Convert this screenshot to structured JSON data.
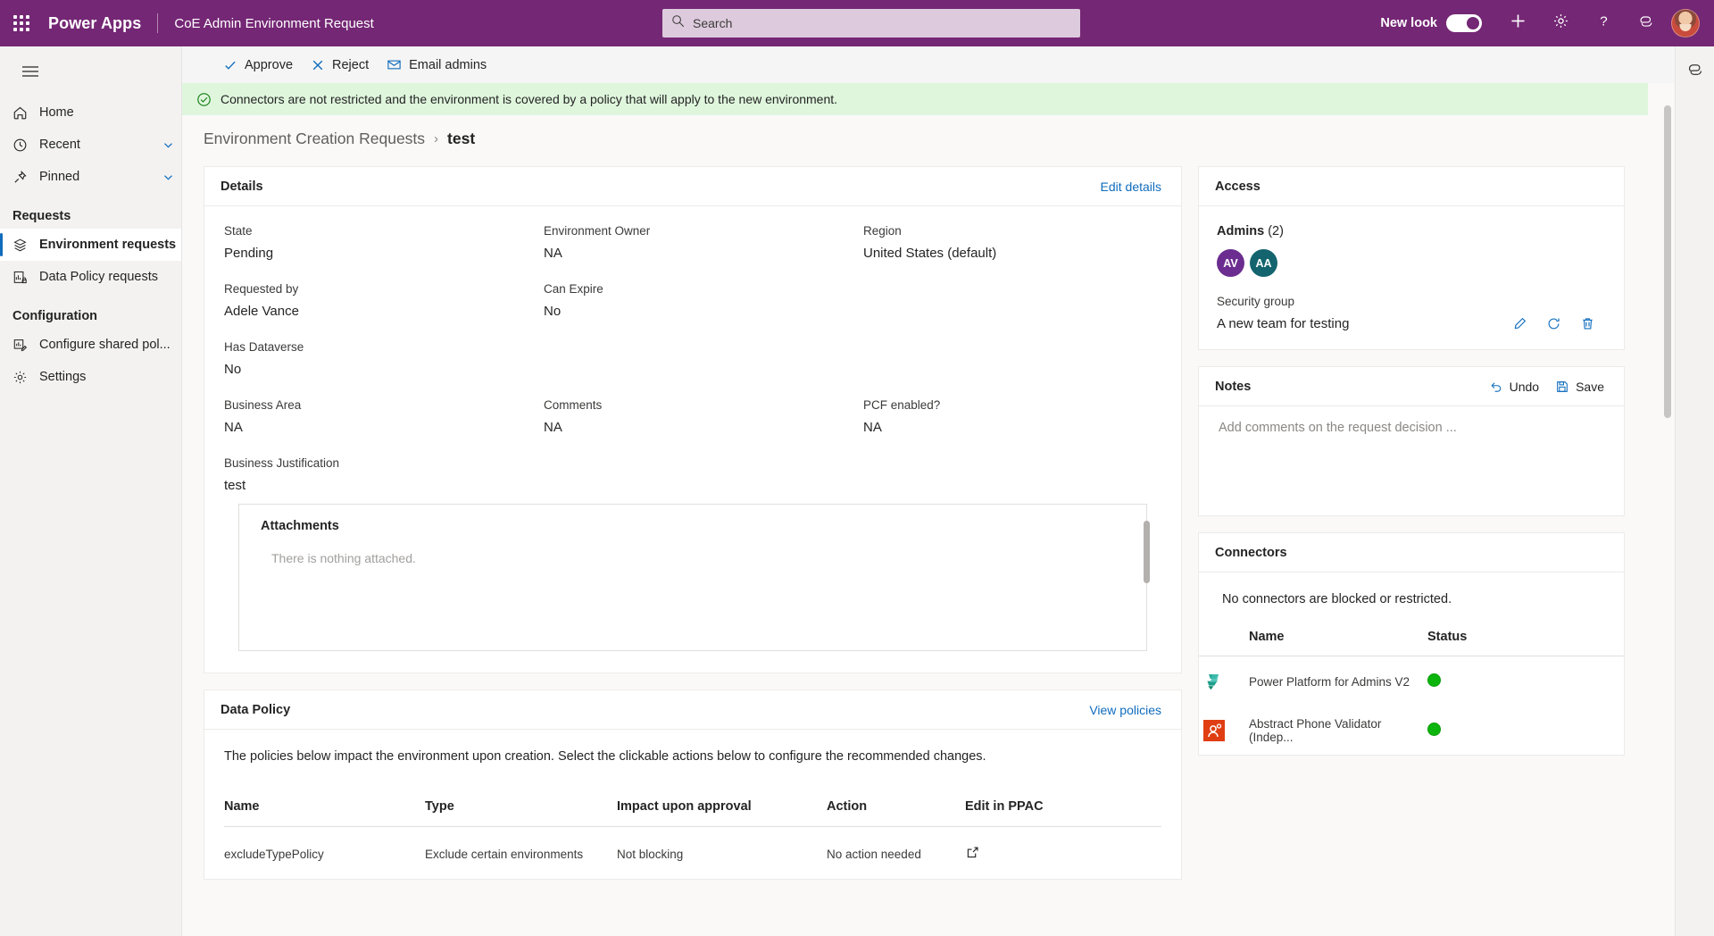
{
  "suitebar": {
    "waffle_label": "App launcher",
    "brand": "Power Apps",
    "app_name": "CoE Admin Environment Request",
    "search_placeholder": "Search",
    "new_look_label": "New look",
    "toggle_on": true,
    "icons": [
      "plus-icon",
      "gear-icon",
      "help-icon",
      "copilot-icon"
    ],
    "accent": "#742774"
  },
  "sidebar": {
    "hamburger": "menu-icon",
    "items": [
      {
        "label": "Home",
        "icon": "home-icon",
        "chevron": false,
        "selected": false
      },
      {
        "label": "Recent",
        "icon": "clock-icon",
        "chevron": true,
        "selected": false
      },
      {
        "label": "Pinned",
        "icon": "pin-icon",
        "chevron": true,
        "selected": false
      }
    ],
    "group_requests": "Requests",
    "requests_items": [
      {
        "label": "Environment requests",
        "icon": "layers-icon",
        "selected": true
      },
      {
        "label": "Data Policy requests",
        "icon": "policy-icon",
        "selected": false
      }
    ],
    "group_configuration": "Configuration",
    "configuration_items": [
      {
        "label": "Configure shared pol...",
        "icon": "configure-icon",
        "selected": false
      },
      {
        "label": "Settings",
        "icon": "gear-icon",
        "selected": false
      }
    ]
  },
  "commandbar": {
    "approve": "Approve",
    "reject": "Reject",
    "email_admins": "Email admins"
  },
  "banner": {
    "icon": "check-circle-icon",
    "text": "Connectors are not restricted and the environment is covered by a policy that will apply to the new environment.",
    "background": "#dff6dd"
  },
  "breadcrumb": {
    "parent": "Environment Creation Requests",
    "separator": "›",
    "current": "test"
  },
  "details": {
    "title": "Details",
    "edit_link": "Edit details",
    "fields": [
      {
        "label": "State",
        "value": "Pending"
      },
      {
        "label": "Environment Owner",
        "value": "NA"
      },
      {
        "label": "Region",
        "value": "United States (default)"
      },
      {
        "label": "Requested by",
        "value": "Adele Vance"
      },
      {
        "label": "Can Expire",
        "value": "No"
      },
      {
        "label": "Has Dataverse",
        "value": "No"
      },
      {
        "label": "Business Area",
        "value": "NA"
      },
      {
        "label": "Comments",
        "value": "NA"
      },
      {
        "label": "PCF enabled?",
        "value": "NA"
      },
      {
        "label": "Business Justification",
        "value": "test"
      }
    ],
    "attachments": {
      "title": "Attachments",
      "empty_text": "There is nothing attached."
    }
  },
  "data_policy": {
    "title": "Data Policy",
    "view_link": "View policies",
    "description": "The policies below impact the environment upon creation. Select the clickable actions below to configure the recommended changes.",
    "columns": [
      "Name",
      "Type",
      "Impact upon approval",
      "Action",
      "Edit in PPAC"
    ],
    "rows": [
      {
        "name": "excludeTypePolicy",
        "type": "Exclude certain environments",
        "impact": "Not blocking",
        "action": "No action needed",
        "edit_icon": "open-in-new-icon"
      }
    ]
  },
  "access": {
    "title": "Access",
    "admins_label": "Admins",
    "admins_count": "(2)",
    "admins": [
      {
        "initials": "AV",
        "color": "#6b2d8f"
      },
      {
        "initials": "AA",
        "color": "#13646e"
      }
    ],
    "security_group_label": "Security group",
    "security_group_value": "A new team for testing",
    "actions": [
      "edit-pencil-icon",
      "refresh-icon",
      "delete-trash-icon"
    ]
  },
  "notes": {
    "title": "Notes",
    "undo_label": "Undo",
    "save_label": "Save",
    "placeholder": "Add comments on the request decision ...",
    "value": ""
  },
  "connectors": {
    "title": "Connectors",
    "empty_text": "No connectors are blocked or restricted.",
    "columns": [
      "Name",
      "Status"
    ],
    "rows": [
      {
        "name": "Power Platform for Admins V2",
        "status_color": "#0bb50b",
        "logo": "power-platform-logo"
      },
      {
        "name": "Abstract Phone Validator (Indep...",
        "status_color": "#0bb50b",
        "logo": "abstract-phone-validator-logo"
      }
    ]
  }
}
